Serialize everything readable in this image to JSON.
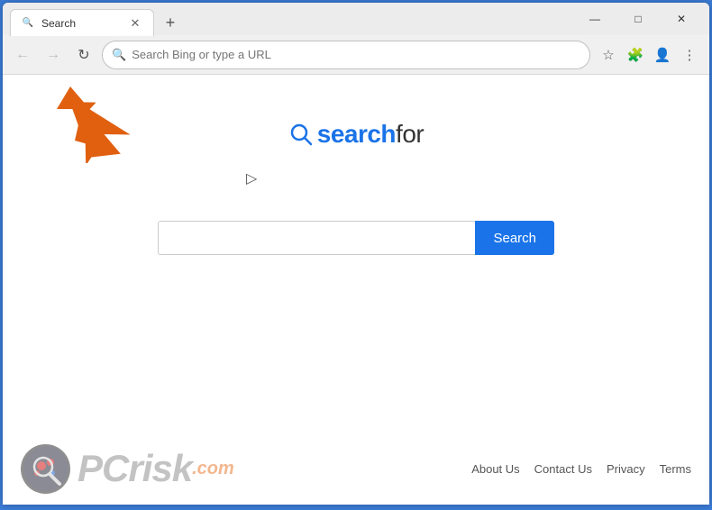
{
  "browser": {
    "tab": {
      "title": "Search",
      "favicon": "🔍"
    },
    "new_tab_label": "+",
    "window_controls": {
      "minimize": "—",
      "maximize": "□",
      "close": "✕"
    },
    "toolbar": {
      "back": "←",
      "forward": "→",
      "refresh": "↻",
      "address_placeholder": "Search Bing or type a URL",
      "address_value": "Search Bing or type a URL",
      "favorites_icon": "☆",
      "extensions_icon": "🧩",
      "profile_icon": "👤",
      "menu_icon": "⋮"
    }
  },
  "page": {
    "logo": {
      "text_blue": "search",
      "text_dark": "for"
    },
    "search": {
      "placeholder": "",
      "button_label": "Search"
    }
  },
  "footer": {
    "pcrisk": {
      "pc_text": "PC",
      "risk_text": "risk",
      "dot_com": ".com"
    },
    "links": [
      {
        "label": "About Us",
        "href": "#"
      },
      {
        "label": "Contact Us",
        "href": "#"
      },
      {
        "label": "Privacy",
        "href": "#"
      },
      {
        "label": "Terms",
        "href": "#"
      }
    ]
  },
  "annotation": {
    "arrow_color": "#e06010"
  }
}
